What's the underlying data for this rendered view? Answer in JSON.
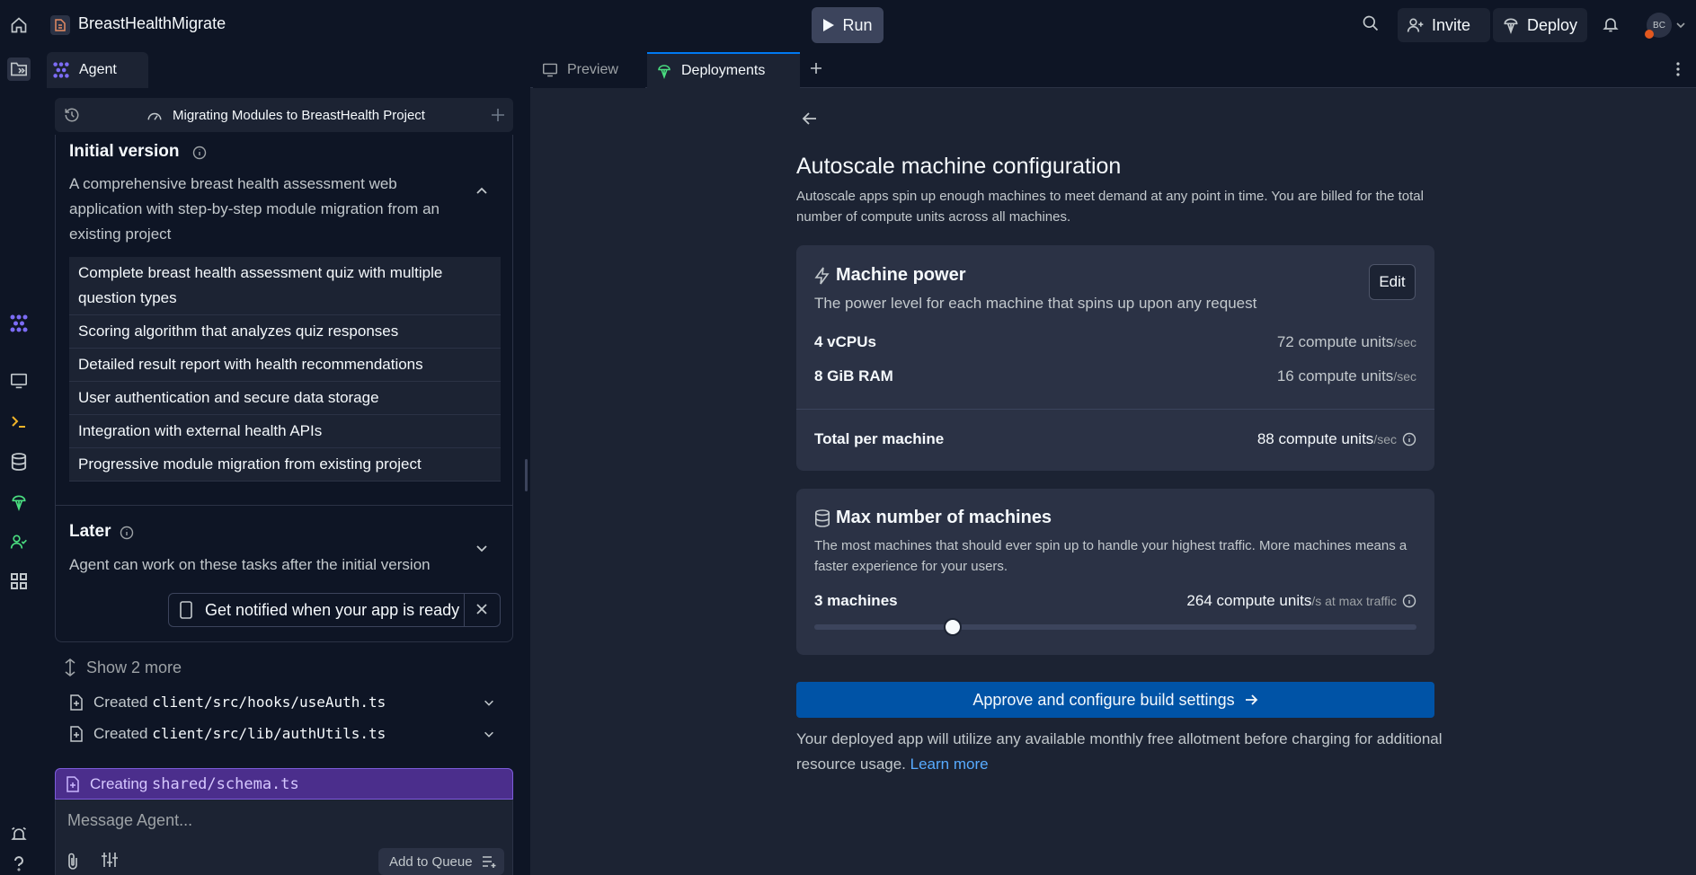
{
  "topbar": {
    "repl_name": "BreastHealthMigrate",
    "run_label": "Run",
    "invite_label": "Invite",
    "deploy_label": "Deploy",
    "avatar_initials": "BC"
  },
  "agent": {
    "tab_label": "Agent",
    "session_title": "Migrating Modules to BreastHealth Project",
    "initial": {
      "title": "Initial version",
      "description": "A comprehensive breast health assessment web application with step-by-step module migration from an existing project",
      "tasks": [
        "Complete breast health assessment quiz with multiple question types",
        "Scoring algorithm that analyzes quiz responses",
        "Detailed result report with health recommendations",
        "User authentication and secure data storage",
        "Integration with external health APIs",
        "Progressive module migration from existing project"
      ]
    },
    "later": {
      "title": "Later",
      "description": "Agent can work on these tasks after the initial version"
    },
    "notify_label": "Get notified when your app is ready",
    "show_more": "Show 2 more",
    "files": [
      {
        "action": "Created",
        "path": "client/src/hooks/useAuth.ts"
      },
      {
        "action": "Created",
        "path": "client/src/lib/authUtils.ts"
      }
    ],
    "creating": {
      "action": "Creating",
      "path": "shared/schema.ts"
    },
    "composer_placeholder": "Message Agent...",
    "queue_label": "Add to Queue"
  },
  "workspace": {
    "tabs": [
      {
        "label": "Preview"
      },
      {
        "label": "Deployments"
      }
    ],
    "title": "Autoscale machine configuration",
    "subtitle": "Autoscale apps spin up enough machines to meet demand at any point in time. You are billed for the total number of compute units across all machines.",
    "power": {
      "title": "Machine power",
      "description": "The power level for each machine that spins up upon any request",
      "edit_label": "Edit",
      "rows": [
        {
          "label": "4 vCPUs",
          "value": "72 compute units",
          "unit": "/sec"
        },
        {
          "label": "8 GiB RAM",
          "value": "16 compute units",
          "unit": "/sec"
        }
      ],
      "total": {
        "label": "Total per machine",
        "value": "88 compute units",
        "unit": "/sec"
      }
    },
    "max": {
      "title": "Max number of machines",
      "description": "The most machines that should ever spin up to handle your highest traffic. More machines means a faster experience for your users.",
      "count_label": "3 machines",
      "value": "264 compute units",
      "unit": "/s at max traffic",
      "slider_fraction": 0.23
    },
    "approve_label": "Approve and configure build settings",
    "footnote": "Your deployed app will utilize any available monthly free allotment before charging for additional resource usage.",
    "learn_more": "Learn more"
  }
}
